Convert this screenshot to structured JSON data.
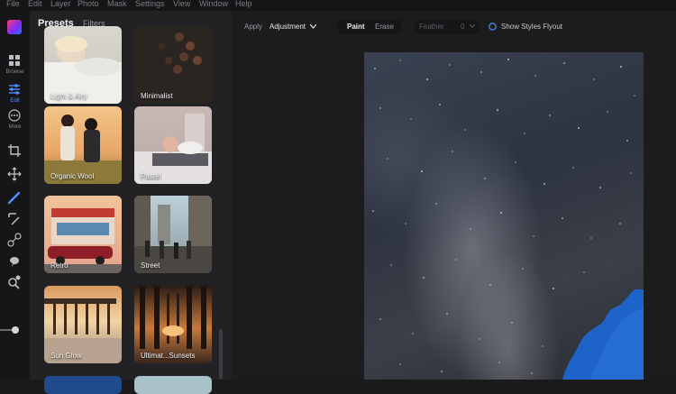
{
  "menu": [
    "File",
    "Edit",
    "Layer",
    "Photo",
    "Mask",
    "Settings",
    "View",
    "Window",
    "Help"
  ],
  "rail": {
    "browse_label": "Browse",
    "edit_label": "Edit",
    "more_label": "More"
  },
  "panel": {
    "tab_presets": "Presets",
    "tab_filters": "Filters",
    "presets": [
      {
        "label": "Light & Airy"
      },
      {
        "label": "Minimalist"
      },
      {
        "label": "Organic Wool"
      },
      {
        "label": "Pastel"
      },
      {
        "label": "Retro"
      },
      {
        "label": "Street"
      },
      {
        "label": "Sun Glow"
      },
      {
        "label": "Ultimat...Sunsets"
      }
    ]
  },
  "options": {
    "apply_label": "Apply",
    "apply_value": "Adjustment",
    "paint_label": "Paint",
    "erase_label": "Erase",
    "feather_label": "Feather",
    "feather_value": "0",
    "show_styles_label": "Show Styles Flyout"
  },
  "colors": {
    "accent": "#4a90ff",
    "panel_bg": "#222225",
    "app_bg": "#1a1a1c"
  }
}
